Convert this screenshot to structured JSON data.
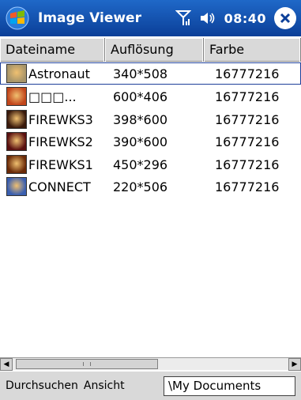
{
  "window": {
    "title": "Image Viewer",
    "clock": "08:40",
    "start_icon": "windows-flag-icon",
    "signal_icon": "antenna-signal-icon",
    "volume_icon": "speaker-icon",
    "close_icon": "close-circle-icon"
  },
  "columns": [
    "Dateiname",
    "Auflösung",
    "Farbe"
  ],
  "files": [
    {
      "name": "Astronaut",
      "resolution": "340*508",
      "color": "16777216",
      "thumb_color": "#a8956a",
      "selected": true
    },
    {
      "name": "□□□...",
      "resolution": "600*406",
      "color": "16777216",
      "thumb_color": "#c2461c",
      "selected": false
    },
    {
      "name": "FIREWKS3",
      "resolution": "398*600",
      "color": "16777216",
      "thumb_color": "#3a1a0c",
      "selected": false
    },
    {
      "name": "FIREWKS2",
      "resolution": "390*600",
      "color": "16777216",
      "thumb_color": "#5a1010",
      "selected": false
    },
    {
      "name": "FIREWKS1",
      "resolution": "450*296",
      "color": "16777216",
      "thumb_color": "#6a2a08",
      "selected": false
    },
    {
      "name": "CONNECT",
      "resolution": "220*506",
      "color": "16777216",
      "thumb_color": "#3a5fb0",
      "selected": false
    }
  ],
  "menu": {
    "browse": "Durchsuchen",
    "view": "Ansicht"
  },
  "path": "\\My Documents"
}
